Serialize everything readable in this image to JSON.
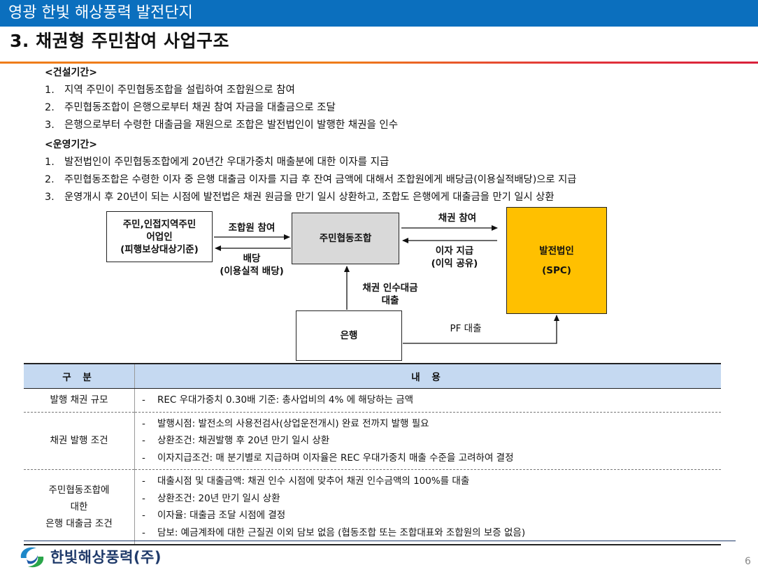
{
  "header": {
    "project": "영광 한빛 해상풍력 발전단지",
    "slide_title": "3. 채권형 주민참여 사업구조"
  },
  "construction": {
    "heading": "<건설기간>",
    "items": [
      {
        "num": "1.",
        "text": "지역 주민이 주민협동조합을 설립하여 조합원으로 참여"
      },
      {
        "num": "2.",
        "text": "주민협동조합이 은행으로부터 채권 참여 자금을 대출금으로 조달"
      },
      {
        "num": "3.",
        "text": "은행으로부터 수령한 대출금을 재원으로 조합은 발전법인이 발행한 채권을 인수"
      }
    ]
  },
  "operation": {
    "heading": "<운영기간>",
    "items": [
      {
        "num": "1.",
        "text": "발전법인이 주민협동조합에게 20년간 우대가중치 매출분에 대한 이자를 지급"
      },
      {
        "num": "2.",
        "text": "주민협동조합은 수령한 이자 중 은행 대출금 이자를 지급 후 잔여 금액에 대해서 조합원에게 배당금(이용실적배당)으로 지급"
      },
      {
        "num": "3.",
        "text": "운영개시 후 20년이 되는 시점에 발전법은 채권 원금을 만기 일시 상환하고, 조합도 은행에게 대출금을 만기 일시 상환"
      }
    ]
  },
  "diagram": {
    "residents": [
      "주민,인접지역주민",
      "어업인",
      "(피행보상대상기준)"
    ],
    "coop": "주민협동조합",
    "spc": [
      "발전법인",
      "(SPC)"
    ],
    "bank": "은행",
    "join_member": "조합원 참여",
    "dividend": [
      "배당",
      "(이용실적 배당)"
    ],
    "bond_participation": "채권 참여",
    "interest": [
      "이자 지급",
      "(이익 공유)"
    ],
    "bond_loan": [
      "채권 인수대금",
      "대출"
    ],
    "pf_loan": "PF 대출",
    "spc_color": "#ffc000",
    "coop_color": "#d9d9d9"
  },
  "table": {
    "headers": [
      "구 분",
      "내 용"
    ],
    "header_color": "#c5d9f1",
    "rows": [
      {
        "label": [
          "발행 채권 규모"
        ],
        "bullets": [
          "REC 우대가중치 0.30배 기준: 총사업비의 4% 에 해당하는 금액"
        ]
      },
      {
        "label": [
          "채권 발행 조건"
        ],
        "bullets": [
          "발행시점: 발전소의 사용전검사(상업운전개시) 완료 전까지 발행 필요",
          "상환조건: 채권발행 후 20년 만기 일시 상환",
          "이자지급조건: 매 분기별로 지급하며 이자율은 REC 우대가중치 매출 수준을 고려하여 결정"
        ]
      },
      {
        "label": [
          "주민협동조합에",
          "대한",
          "은행 대출금 조건"
        ],
        "bullets": [
          "대출시점 및 대출금액: 채권 인수 시점에 맞추어 채권 인수금액의 100%를 대출",
          "상환조건: 20년 만기 일시 상환",
          "이자율: 대출금 조달 시점에 결정",
          "담보: 예금계좌에 대한 근질권 이외 담보 없음 (협동조합 또는 조합대표와 조합원의 보증 없음)"
        ]
      }
    ]
  },
  "footer": {
    "company": "한빛해상풍력(주)",
    "page": "6",
    "logo_icon": "wave-swirl-logo-icon"
  }
}
